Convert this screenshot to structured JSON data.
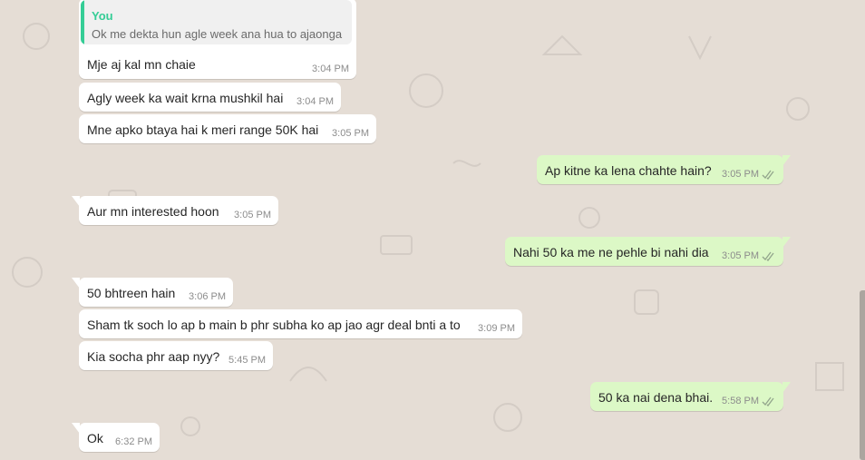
{
  "chat": {
    "quoted": {
      "author": "You",
      "text": "Ok me dekta hun agle week ana hua to ajaonga"
    },
    "messages": [
      {
        "direction": "in",
        "text": "Mje aj kal mn chaie",
        "time": "3:04 PM"
      },
      {
        "direction": "in",
        "text": "Agly week ka wait krna mushkil hai",
        "time": "3:04 PM"
      },
      {
        "direction": "in",
        "text": "Mne apko btaya hai k meri range 50K hai",
        "time": "3:05 PM"
      },
      {
        "direction": "out",
        "text": "Ap kitne ka lena chahte hain?",
        "time": "3:05 PM",
        "status": "read-ticks-icon"
      },
      {
        "direction": "in",
        "text": "Aur mn interested hoon",
        "time": "3:05 PM"
      },
      {
        "direction": "out",
        "text": "Nahi 50 ka me ne pehle bi nahi dia",
        "time": "3:05 PM",
        "status": "read-ticks-icon"
      },
      {
        "direction": "in",
        "text": "50 bhtreen hain",
        "time": "3:06 PM"
      },
      {
        "direction": "in",
        "text": "Sham tk soch lo ap b main b phr subha ko ap jao agr deal bnti a to",
        "time": "3:09 PM"
      },
      {
        "direction": "in",
        "text": "Kia socha phr aap nyy?",
        "time": "5:45 PM"
      },
      {
        "direction": "out",
        "text": "50 ka nai dena bhai.",
        "time": "5:58 PM",
        "status": "read-ticks-icon"
      },
      {
        "direction": "in",
        "text": "Ok",
        "time": "6:32 PM"
      }
    ]
  },
  "colors": {
    "background": "#e5ddd5",
    "incoming_bubble": "#ffffff",
    "outgoing_bubble": "#dcf8c6",
    "quote_accent": "#35cd96",
    "timestamp": "#8c8c8c",
    "ticks": "#92a58c"
  }
}
